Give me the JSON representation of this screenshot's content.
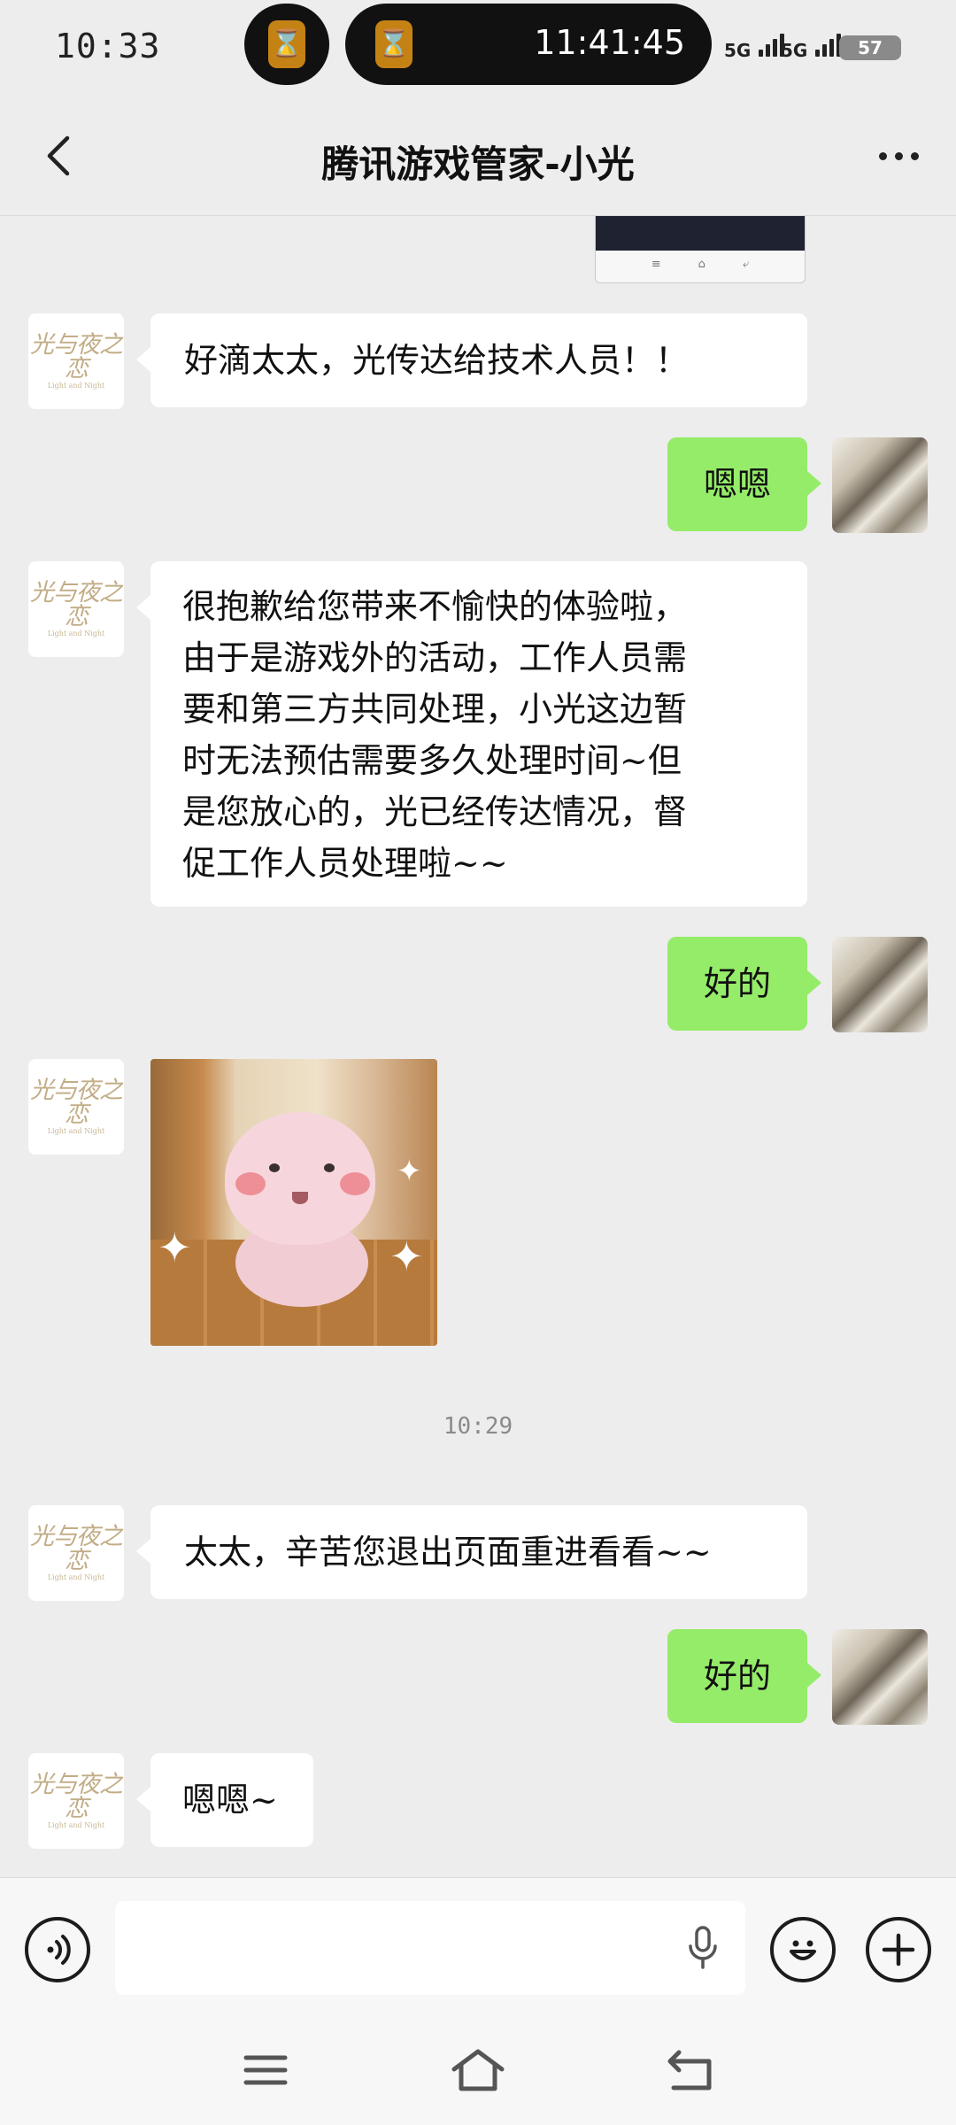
{
  "status_bar": {
    "time": "10:33",
    "timer": "11:41:45",
    "network1": "5G",
    "network2": "5G",
    "battery": "57",
    "accent_color": "#c58214"
  },
  "header": {
    "title": "腾讯游戏管家-小光",
    "back_icon": "chevron-left-icon",
    "more_icon": "more-dots-icon"
  },
  "messages": [
    {
      "from": "bot",
      "type": "text",
      "text": "好滴太太，光传达给技术人员！！"
    },
    {
      "from": "me",
      "type": "text",
      "text": "嗯嗯"
    },
    {
      "from": "bot",
      "type": "text",
      "lines": [
        "很抱歉给您带来不愉快的体验啦，",
        "由于是游戏外的活动，工作人员需",
        "要和第三方共同处理，小光这边暂",
        "时无法预估需要多久处理时间~但",
        "是您放心的，光已经传达情况，督",
        "促工作人员处理啦~~"
      ]
    },
    {
      "from": "me",
      "type": "text",
      "text": "好的"
    },
    {
      "from": "bot",
      "type": "sticker",
      "sticker": "pink-pig-sticker"
    },
    {
      "type": "time",
      "text": "10:29"
    },
    {
      "from": "bot",
      "type": "text",
      "text": "太太，辛苦您退出页面重进看看~~"
    },
    {
      "from": "me",
      "type": "text",
      "text": "好的"
    },
    {
      "from": "bot",
      "type": "text",
      "text": "嗯嗯~"
    }
  ],
  "bot_avatar": {
    "logo_text": "光与夜之恋",
    "logo_sub": "Light and Night",
    "color": "#c2ad86"
  },
  "input_bar": {
    "value": "",
    "voice_icon": "voice-icon",
    "mic_icon": "microphone-icon",
    "emoji_icon": "emoji-icon",
    "plus_icon": "plus-icon"
  },
  "nav_bar": {
    "menu_icon": "menu-icon",
    "home_icon": "home-icon",
    "back_icon": "back-icon"
  },
  "colors": {
    "outgoing_bubble": "#95ec69",
    "incoming_bubble": "#ffffff",
    "background": "#ededed"
  }
}
